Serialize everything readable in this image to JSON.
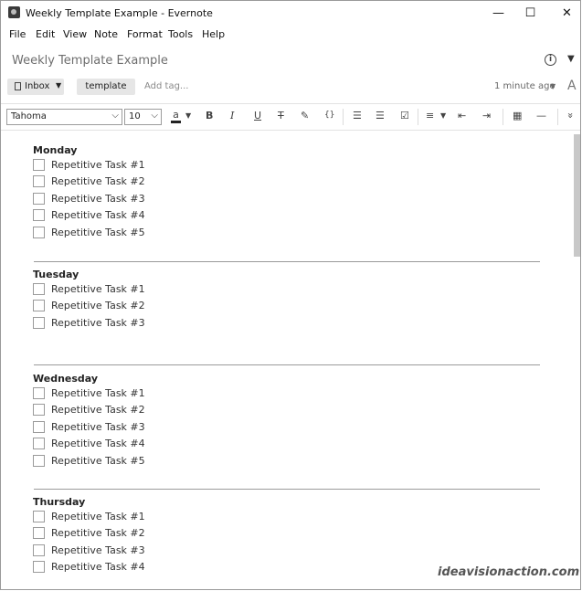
{
  "window": {
    "title": "Weekly Template Example - Evernote",
    "minimize": "—",
    "maximize": "☐",
    "close": "✕"
  },
  "menu": [
    "File",
    "Edit",
    "View",
    "Note",
    "Format",
    "Tools",
    "Help"
  ],
  "note": {
    "title": "Weekly Template Example",
    "notebook": "Inbox",
    "tag": "template",
    "add_tag_placeholder": "Add tag...",
    "updated": "1 minute ago"
  },
  "toolbar": {
    "font": "Tahoma",
    "size": "10",
    "text_color_glyph": "a",
    "bold": "B",
    "italic": "I",
    "underline": "U",
    "strikethrough": "T",
    "highlight": "✎",
    "code": "{}",
    "bullets": "☰",
    "numbers": "☰",
    "checkbox": "☑",
    "align": "≡",
    "outdent": "⇤",
    "indent": "⇥",
    "table": "▦",
    "rule": "—",
    "more": "»"
  },
  "days": [
    {
      "name": "Monday",
      "tasks": [
        "Repetitive Task #1",
        "Repetitive Task #2",
        "Repetitive Task #3",
        "Repetitive Task #4",
        "Repetitive Task #5"
      ]
    },
    {
      "name": "Tuesday",
      "tasks": [
        "Repetitive Task #1",
        "Repetitive Task #2",
        "Repetitive Task #3"
      ]
    },
    {
      "name": "Wednesday",
      "tasks": [
        "Repetitive Task #1",
        "Repetitive Task #2",
        "Repetitive Task #3",
        "Repetitive Task #4",
        "Repetitive Task #5"
      ]
    },
    {
      "name": "Thursday",
      "tasks": [
        "Repetitive Task #1",
        "Repetitive Task #2",
        "Repetitive Task #3",
        "Repetitive Task #4"
      ]
    }
  ],
  "watermark": "ideavisionaction.com",
  "colors": {
    "text_color_underline": "#222222",
    "toolbar_bg": "#ffffff"
  }
}
